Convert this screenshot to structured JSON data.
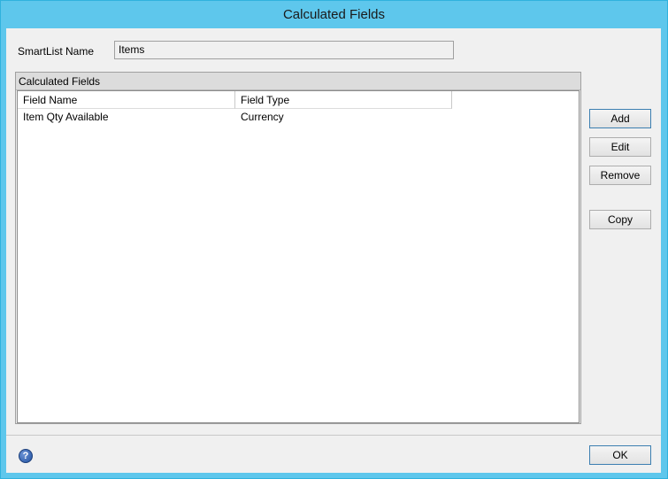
{
  "window": {
    "title": "Calculated Fields"
  },
  "form": {
    "smartlist_label": "SmartList Name",
    "smartlist_value": "Items"
  },
  "group": {
    "title": "Calculated Fields",
    "columns": [
      "Field Name",
      "Field Type"
    ],
    "rows": [
      {
        "field_name": "Item Qty Available",
        "field_type": "Currency"
      }
    ]
  },
  "buttons": {
    "add": "Add",
    "edit": "Edit",
    "remove": "Remove",
    "copy": "Copy",
    "ok": "OK"
  },
  "icons": {
    "help": "help-icon",
    "help_glyph": "?"
  },
  "colors": {
    "titlebar": "#5ec7ec",
    "window_bg": "#f0f0f0"
  }
}
